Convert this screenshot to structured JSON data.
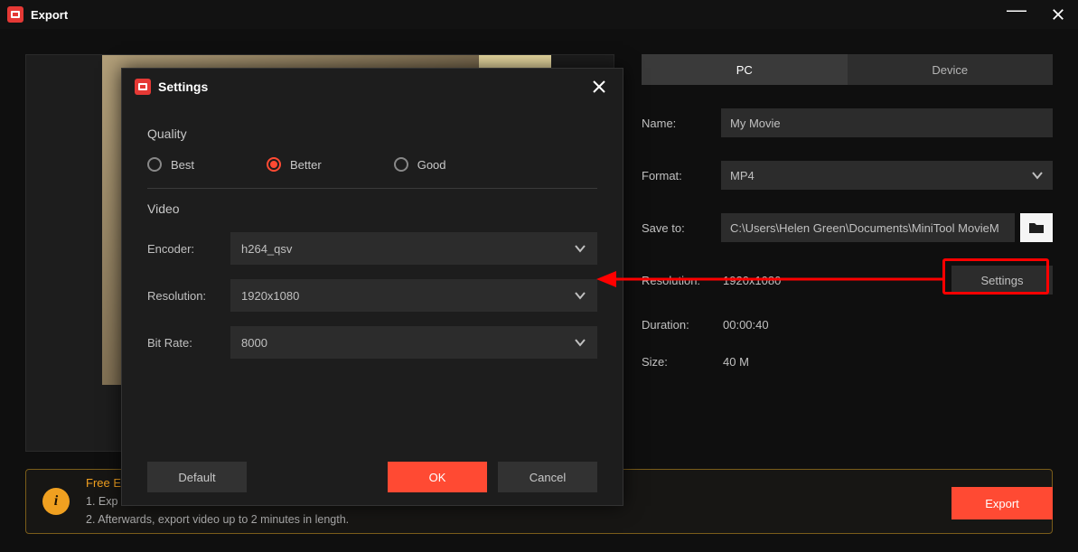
{
  "titlebar": {
    "title": "Export"
  },
  "tabs": {
    "pc": "PC",
    "device": "Device"
  },
  "fields": {
    "name_label": "Name:",
    "name_value": "My Movie",
    "format_label": "Format:",
    "format_value": "MP4",
    "saveto_label": "Save to:",
    "saveto_value": "C:\\Users\\Helen Green\\Documents\\MiniTool MovieM",
    "resolution_label": "Resolution:",
    "resolution_value": "1920x1080",
    "settings_btn": "Settings",
    "duration_label": "Duration:",
    "duration_value": "00:00:40",
    "size_label": "Size:",
    "size_value": "40 M"
  },
  "banner": {
    "title": "Free E",
    "line1": "1. Exp",
    "line2": "2. Afterwards, export video up to 2 minutes in length."
  },
  "export_btn": "Export",
  "settings_dialog": {
    "title": "Settings",
    "quality_section": "Quality",
    "video_section": "Video",
    "radios": {
      "best": "Best",
      "better": "Better",
      "good": "Good"
    },
    "encoder_label": "Encoder:",
    "encoder_value": "h264_qsv",
    "resolution_label": "Resolution:",
    "resolution_value": "1920x1080",
    "bitrate_label": "Bit Rate:",
    "bitrate_value": "8000",
    "default_btn": "Default",
    "ok_btn": "OK",
    "cancel_btn": "Cancel"
  }
}
